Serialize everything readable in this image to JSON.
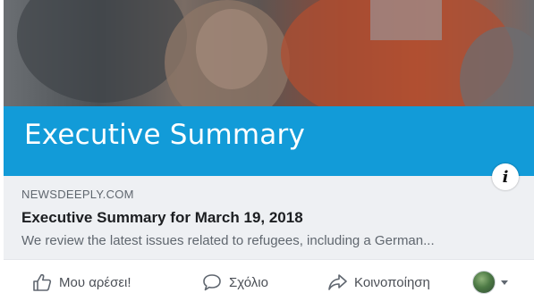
{
  "link_preview": {
    "banner_title": "Executive Summary",
    "info_icon_glyph": "i",
    "domain": "NEWSDEEPLY.COM",
    "headline": "Executive Summary for March 19, 2018",
    "description": "We review the latest issues related to refugees, including a German..."
  },
  "actions": {
    "like_label": "Μου αρέσει!",
    "comment_label": "Σχόλιο",
    "share_label": "Κοινοποίηση",
    "like_icon": "thumbs-up-icon",
    "comment_icon": "speech-bubble-icon",
    "share_icon": "share-arrow-icon",
    "menu_icon": "caret-down-icon"
  },
  "colors": {
    "banner": "#129bd8",
    "meta_background": "#eef0f3",
    "headline": "#1c1e21",
    "secondary_text": "#60676f"
  }
}
